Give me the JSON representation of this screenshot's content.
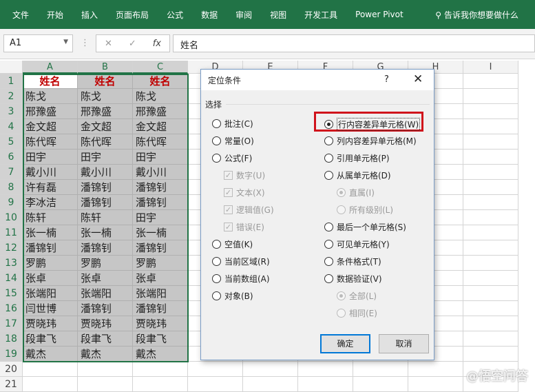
{
  "ribbon": {
    "tabs": [
      "文件",
      "开始",
      "插入",
      "页面布局",
      "公式",
      "数据",
      "审阅",
      "视图",
      "开发工具",
      "Power Pivot"
    ],
    "search": "告诉我你想要做什么"
  },
  "formula_bar": {
    "name_box": "A1",
    "fx": "fx",
    "value": "姓名"
  },
  "columns": [
    "A",
    "B",
    "C",
    "D",
    "E",
    "F",
    "G",
    "H",
    "I"
  ],
  "rows": [
    [
      "姓名",
      "姓名",
      "姓名"
    ],
    [
      "陈戈",
      "陈戈",
      "陈戈"
    ],
    [
      "邢豫盛",
      "邢豫盛",
      "邢豫盛"
    ],
    [
      "金文超",
      "金文超",
      "金文超"
    ],
    [
      "陈代晖",
      "陈代晖",
      "陈代晖"
    ],
    [
      "田宇",
      "田宇",
      "田宇"
    ],
    [
      "戴小川",
      "戴小川",
      "戴小川"
    ],
    [
      "许有磊",
      "潘锦钊",
      "潘锦钊"
    ],
    [
      "李冰洁",
      "潘锦钊",
      "潘锦钊"
    ],
    [
      "陈轩",
      "陈轩",
      "田宇"
    ],
    [
      "张一楠",
      "张一楠",
      "张一楠"
    ],
    [
      "潘锦钊",
      "潘锦钊",
      "潘锦钊"
    ],
    [
      "罗鹏",
      "罗鹏",
      "罗鹏"
    ],
    [
      "张卓",
      "张卓",
      "张卓"
    ],
    [
      "张端阳",
      "张端阳",
      "张端阳"
    ],
    [
      "闫世博",
      "潘锦钊",
      "潘锦钊"
    ],
    [
      "贾晓玮",
      "贾晓玮",
      "贾晓玮"
    ],
    [
      "段聿飞",
      "段聿飞",
      "段聿飞"
    ],
    [
      "戴杰",
      "戴杰",
      "戴杰"
    ],
    [
      "",
      "",
      " "
    ],
    [
      "",
      "",
      ""
    ]
  ],
  "dialog": {
    "title": "定位条件",
    "help": "?",
    "close": "✕",
    "group": "选择",
    "left": [
      {
        "label": "批注(C)",
        "type": "radio"
      },
      {
        "label": "常量(O)",
        "type": "radio"
      },
      {
        "label": "公式(F)",
        "type": "radio"
      },
      {
        "label": "数字(U)",
        "type": "check",
        "disabled": true
      },
      {
        "label": "文本(X)",
        "type": "check",
        "disabled": true
      },
      {
        "label": "逻辑值(G)",
        "type": "check",
        "disabled": true
      },
      {
        "label": "错误(E)",
        "type": "check",
        "disabled": true
      },
      {
        "label": "空值(K)",
        "type": "radio"
      },
      {
        "label": "当前区域(R)",
        "type": "radio"
      },
      {
        "label": "当前数组(A)",
        "type": "radio"
      },
      {
        "label": "对象(B)",
        "type": "radio"
      }
    ],
    "right": [
      {
        "label": "行内容差异单元格(W)",
        "type": "radio",
        "checked": true
      },
      {
        "label": "列内容差异单元格(M)",
        "type": "radio"
      },
      {
        "label": "引用单元格(P)",
        "type": "radio"
      },
      {
        "label": "从属单元格(D)",
        "type": "radio"
      },
      {
        "label": "直属(I)",
        "type": "radio",
        "disabled": true,
        "checked": true
      },
      {
        "label": "所有级别(L)",
        "type": "radio",
        "disabled": true
      },
      {
        "label": "最后一个单元格(S)",
        "type": "radio"
      },
      {
        "label": "可见单元格(Y)",
        "type": "radio"
      },
      {
        "label": "条件格式(T)",
        "type": "radio"
      },
      {
        "label": "数据验证(V)",
        "type": "radio"
      },
      {
        "label": "全部(L)",
        "type": "radio",
        "disabled": true,
        "checked": true
      },
      {
        "label": "相同(E)",
        "type": "radio",
        "disabled": true
      }
    ],
    "ok": "确定",
    "cancel": "取消"
  },
  "watermark": "@悟空问答"
}
